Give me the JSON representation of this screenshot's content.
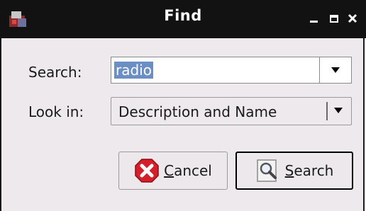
{
  "window": {
    "title": "Find",
    "icons": {
      "app": "app-icon",
      "minimize": "minimize-icon",
      "maximize": "maximize-icon",
      "close": "close-icon"
    }
  },
  "form": {
    "search_label": "Search:",
    "search_value": "radio",
    "lookin_label": "Look in:",
    "lookin_value": "Description and Name"
  },
  "buttons": {
    "cancel_label_first": "C",
    "cancel_label_rest": "ancel",
    "search_label_first": "S",
    "search_label_rest": "earch"
  },
  "colors": {
    "titlebar": "#121212",
    "background": "#ede9ec",
    "selection": "#6b8fc4"
  }
}
